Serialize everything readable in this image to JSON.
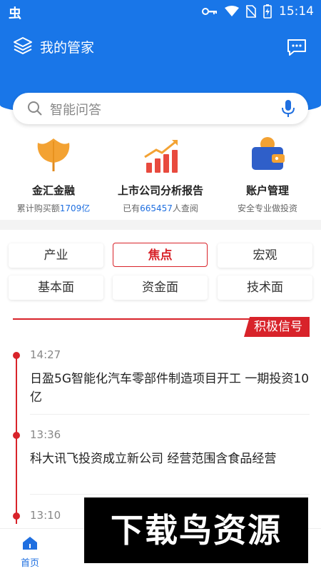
{
  "statusbar": {
    "app_glyph": "虫",
    "time": "15:14",
    "icons": [
      "key-icon",
      "wifi-icon",
      "no-sim-icon",
      "battery-charging-icon"
    ]
  },
  "header": {
    "title": "我的管家"
  },
  "search": {
    "placeholder": "智能问答"
  },
  "features": [
    {
      "title": "金汇金融",
      "sub_pre": "累计购买额",
      "sub_hl": "1709亿",
      "sub_post": "",
      "icon": "ginkgo-leaf-icon"
    },
    {
      "title": "上市公司分析报告",
      "sub_pre": "已有",
      "sub_hl": "665457",
      "sub_post": "人查阅",
      "icon": "bar-chart-up-icon"
    },
    {
      "title": "账户管理",
      "sub_pre": "安全专业做投资",
      "sub_hl": "",
      "sub_post": "",
      "icon": "wallet-icon"
    }
  ],
  "tags": {
    "row1": [
      "产业",
      "焦点",
      "宏观"
    ],
    "row2": [
      "基本面",
      "资金面",
      "技术面"
    ],
    "active": "焦点"
  },
  "signal": {
    "label": "积极信号"
  },
  "timeline": [
    {
      "time": "14:27",
      "text": "日盈5G智能化汽车零部件制造项目开工 一期投资10亿"
    },
    {
      "time": "13:36",
      "text": "科大讯飞投资成立新公司 经营范围含食品经营"
    },
    {
      "time": "13:10",
      "text": ""
    }
  ],
  "tabbar": {
    "home_label": "首页"
  },
  "watermark": {
    "text": "下载鸟资源"
  },
  "colors": {
    "brand": "#1976e8",
    "accent_red": "#d8232a",
    "highlight_blue": "#1f6fe0"
  }
}
